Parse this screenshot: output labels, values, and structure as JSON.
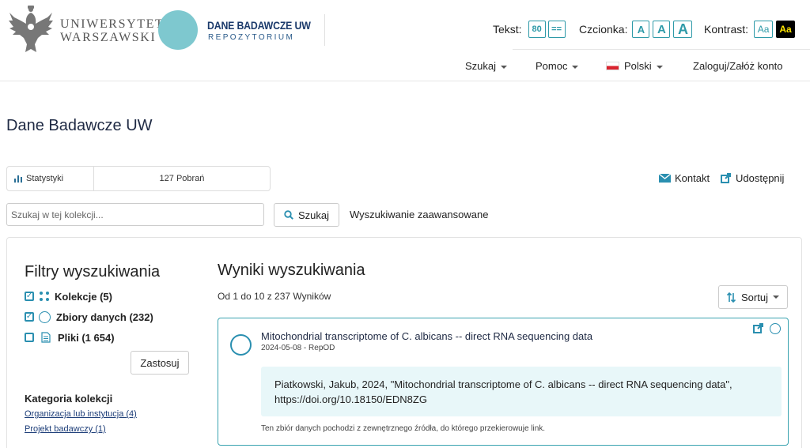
{
  "header": {
    "university_line1": "UNIWERSYTET",
    "university_line2": "WARSZAWSKI",
    "repo_title": "DANE BADAWCZE UW",
    "repo_subtitle": "REPOZYTORIUM"
  },
  "accessibility": {
    "text_label": "Tekst:",
    "text_size": "80",
    "text_spacing": "==",
    "font_label": "Czcionka:",
    "font_options": [
      "A",
      "A",
      "A"
    ],
    "contrast_label": "Kontrast:",
    "contrast_options": [
      "Aa",
      "Aa"
    ]
  },
  "nav": {
    "search": "Szukaj",
    "help": "Pomoc",
    "language": "Polski",
    "login": "Zaloguj/Załóż konto"
  },
  "page_title": "Dane Badawcze UW",
  "stats": {
    "label": "Statystyki",
    "downloads": "127 Pobrań"
  },
  "actions": {
    "contact": "Kontakt",
    "share": "Udostępnij"
  },
  "search": {
    "placeholder": "Szukaj w tej kolekcji...",
    "button": "Szukaj",
    "advanced": "Wyszukiwanie zaawansowane"
  },
  "filters": {
    "title": "Filtry wyszukiwania",
    "items": [
      {
        "label": "Kolekcje (5)",
        "checked": true
      },
      {
        "label": "Zbiory danych (232)",
        "checked": true
      },
      {
        "label": "Pliki (1 654)",
        "checked": false
      }
    ],
    "apply": "Zastosuj",
    "category_heading": "Kategoria kolekcji",
    "categories": [
      "Organizacja lub instytucja (4)",
      "Projekt badawczy (1)"
    ]
  },
  "results": {
    "title": "Wyniki wyszukiwania",
    "count": "Od 1 do 10 z 237 Wyników",
    "sort": "Sortuj",
    "items": [
      {
        "title": "Mitochondrial transcriptome of C. albicans -- direct RNA sequencing data",
        "date": "2024-05-08",
        "source": "RepOD",
        "citation_line1": "Piatkowski, Jakub, 2024, \"Mitochondrial transcriptome of C. albicans -- direct RNA sequencing data\",",
        "citation_line2": "https://doi.org/10.18150/EDN8ZG",
        "note": "Ten zbiór danych pochodzi z zewnętrznego źródła, do którego przekierowuje link."
      }
    ]
  },
  "colors": {
    "accent": "#2a8fb0",
    "teal_circle": "#7ec8cf",
    "navy": "#1b3a6b",
    "citation_bg": "#e8f7f9",
    "contrast_yellow": "#ffe600"
  }
}
